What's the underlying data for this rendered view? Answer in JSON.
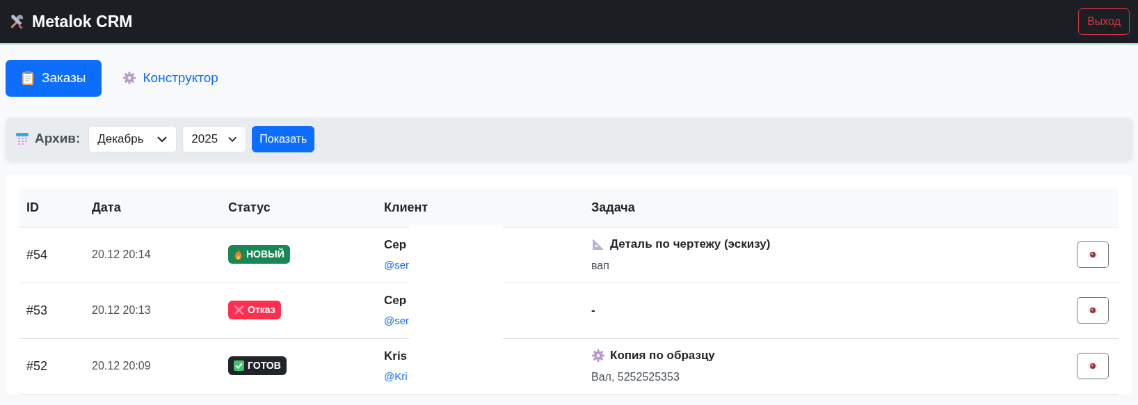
{
  "navbar": {
    "brand": "Metalok CRM",
    "logout": "Выход"
  },
  "tabs": [
    {
      "label": "Заказы",
      "kind": "orders",
      "selected": true
    },
    {
      "label": "Конструктор",
      "kind": "builder",
      "selected": false
    }
  ],
  "archive": {
    "label": "Архив:",
    "month": "Декабрь",
    "year": "2025",
    "button": "Показать"
  },
  "table": {
    "columns": [
      "ID",
      "Дата",
      "Статус",
      "Клиент",
      "Задача"
    ],
    "rows": [
      {
        "id": "#54",
        "date": "20.12 20:14",
        "status": {
          "text": "НОВЫЙ",
          "kind": "new",
          "color": "#198754"
        },
        "client": {
          "name": "Сер",
          "handle": "@ser"
        },
        "task": {
          "kind": "drawing",
          "title": "Деталь по чертежу (эскизу)",
          "note": "вап"
        }
      },
      {
        "id": "#53",
        "date": "20.12 20:13",
        "status": {
          "text": "Отказ",
          "kind": "rejected",
          "color": "#fd2f4f"
        },
        "client": {
          "name": "Сер",
          "handle": "@ser"
        },
        "task": {
          "kind": "none",
          "title": "-"
        }
      },
      {
        "id": "#52",
        "date": "20.12 20:09",
        "status": {
          "text": "ГОТОВ",
          "kind": "done",
          "color": "#212529"
        },
        "client": {
          "name": "Kris",
          "handle": "@Kri"
        },
        "task": {
          "kind": "copy",
          "title": "Копия по образцу",
          "note": "Вал, 5252525353"
        }
      }
    ]
  }
}
